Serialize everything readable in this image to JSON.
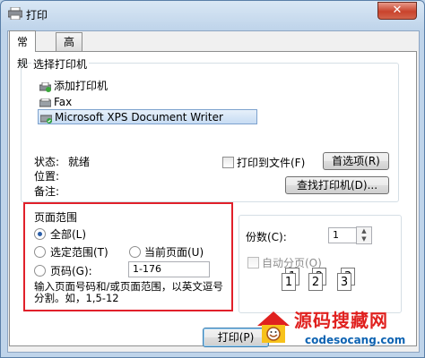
{
  "window": {
    "title": "打印",
    "close_label": "✕"
  },
  "tabs": [
    {
      "label": "常规"
    },
    {
      "label": "高级"
    }
  ],
  "printer_group": {
    "label": "选择打印机",
    "items": [
      {
        "label": "添加打印机"
      },
      {
        "label": "Fax"
      },
      {
        "label": "Microsoft XPS Document Writer"
      }
    ],
    "selected_index": 2
  },
  "status": {
    "state_label": "状态:",
    "state_value": "就绪",
    "location_label": "位置:",
    "comment_label": "备注:"
  },
  "print_to_file_label": "打印到文件(F)",
  "preferences_button": "首选项(R)",
  "find_printer_button": "查找打印机(D)...",
  "page_range": {
    "label": "页面范围",
    "all_label": "全部(L)",
    "selection_label": "选定范围(T)",
    "current_label": "当前页面(U)",
    "pages_label": "页码(G):",
    "pages_value": "1-176",
    "hint": "输入页面号码和/或页面范围，以英文逗号分割。如，1,5-12"
  },
  "copies": {
    "label": "份数(C):",
    "value": "1",
    "collate_label": "自动分页(O)",
    "page_numbers": [
      "1",
      "1",
      "2",
      "2",
      "3",
      "3"
    ]
  },
  "print_button": "打印(P)",
  "watermark": {
    "text": "源码搜藏网",
    "url": "codesocang.com"
  },
  "colors": {
    "highlight": "#e1202a",
    "selection": "#c7dcf3"
  },
  "icons": {
    "title": "printer-icon",
    "add": "add-printer-icon",
    "fax": "fax-icon",
    "xps": "xps-printer-icon"
  }
}
